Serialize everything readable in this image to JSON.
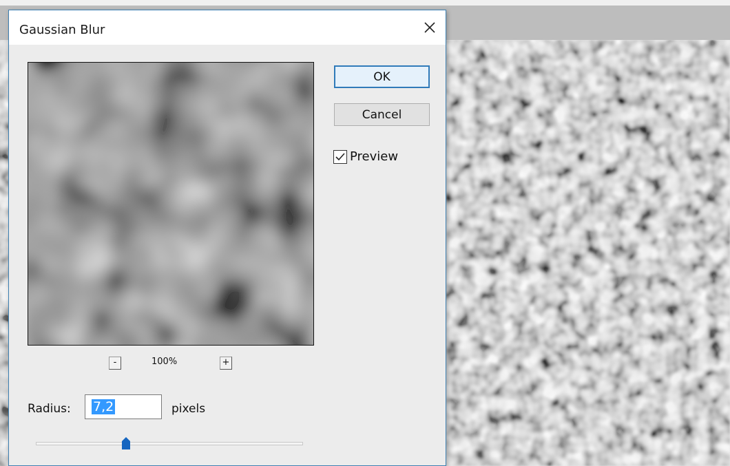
{
  "dialog": {
    "title": "Gaussian Blur",
    "close_icon": "close-icon"
  },
  "buttons": {
    "ok_label": "OK",
    "cancel_label": "Cancel"
  },
  "preview_toggle": {
    "label": "Preview",
    "checked": true
  },
  "zoom": {
    "out_label": "-",
    "in_label": "+",
    "level": "100%"
  },
  "radius": {
    "label": "Radius:",
    "value": "7,2",
    "unit": "pixels",
    "slider_fraction": 0.33
  },
  "colors": {
    "accent": "#2f7ab9",
    "selection": "#3399ff",
    "slider_thumb": "#1565c0"
  }
}
